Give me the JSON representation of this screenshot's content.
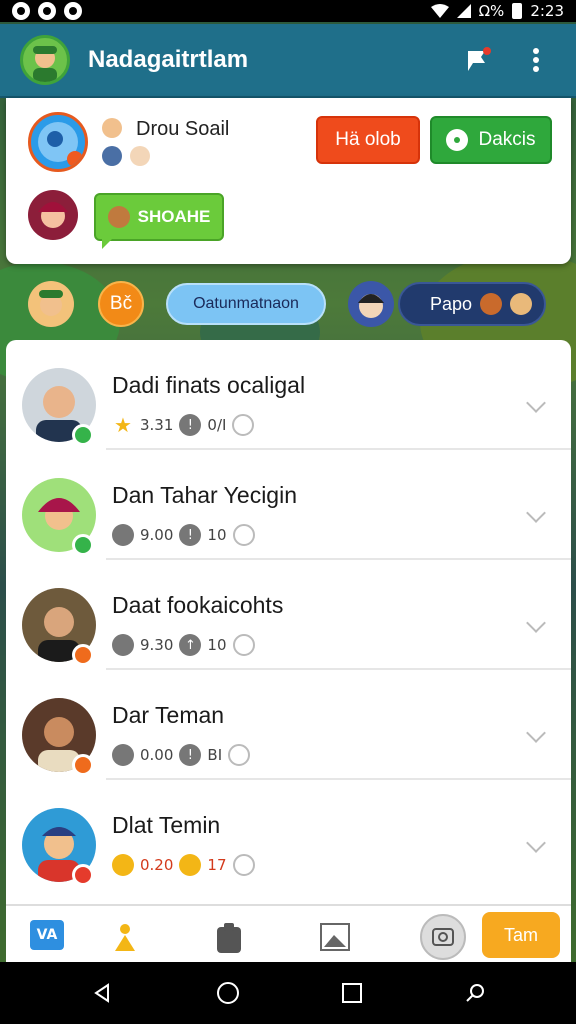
{
  "status_bar": {
    "right_text": "Ω%",
    "time": "2:23"
  },
  "header": {
    "title": "Nadagaitrtlam",
    "icons": [
      "avatar",
      "flag-chat-icon",
      "more-vert-icon"
    ]
  },
  "group": {
    "title": "Drou Soail",
    "buttons": {
      "red_label": "Hä olob",
      "green_label": "Dakcis"
    },
    "share_label": "SHOAHE"
  },
  "pills": {
    "orange_label": "Bč",
    "blue_label": "Oatunmatnaon",
    "dark_label": "Papo"
  },
  "list": [
    {
      "name": "Dadi finats ocaligal",
      "stat1": "3.31",
      "stat2": "0/I",
      "badge": "green"
    },
    {
      "name": "Dan Tahar Yecigin",
      "stat1": "9.00",
      "stat2": "10",
      "badge": "green"
    },
    {
      "name": "Daat fookaicohts",
      "stat1": "9.30",
      "stat2": "10",
      "badge": "orange"
    },
    {
      "name": "Dar Teman",
      "stat1": "0.00",
      "stat2": "BI",
      "badge": "orange"
    },
    {
      "name": "Dlat Temin",
      "stat1": "0.20",
      "stat2": "17",
      "badge": "red"
    }
  ],
  "bottom_bar": {
    "first_label": "VA",
    "team_label": "Tam"
  },
  "colors": {
    "header": "#1f6f8a",
    "red": "#ef4b1c",
    "green": "#2fa83c",
    "orange": "#f7a920"
  }
}
